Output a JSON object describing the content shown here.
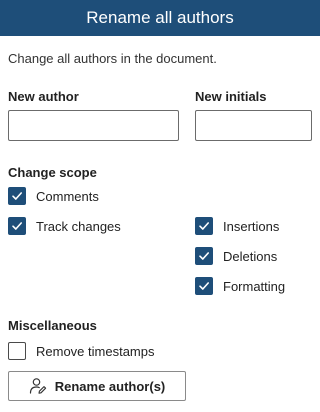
{
  "header": {
    "title": "Rename all authors"
  },
  "description": "Change all authors in the document.",
  "fields": {
    "new_author_label": "New author",
    "new_author_value": "",
    "new_initials_label": "New initials",
    "new_initials_value": ""
  },
  "scope": {
    "heading": "Change scope",
    "comments": {
      "label": "Comments",
      "checked": true
    },
    "track_changes": {
      "label": "Track changes",
      "checked": true
    },
    "insertions": {
      "label": "Insertions",
      "checked": true
    },
    "deletions": {
      "label": "Deletions",
      "checked": true
    },
    "formatting": {
      "label": "Formatting",
      "checked": true
    }
  },
  "misc": {
    "heading": "Miscellaneous",
    "remove_timestamps": {
      "label": "Remove timestamps",
      "checked": false
    }
  },
  "action": {
    "button_label": "Rename author(s)",
    "icon": "person-edit-icon"
  },
  "colors": {
    "accent": "#1e4e79",
    "header_text": "#ffffff"
  }
}
